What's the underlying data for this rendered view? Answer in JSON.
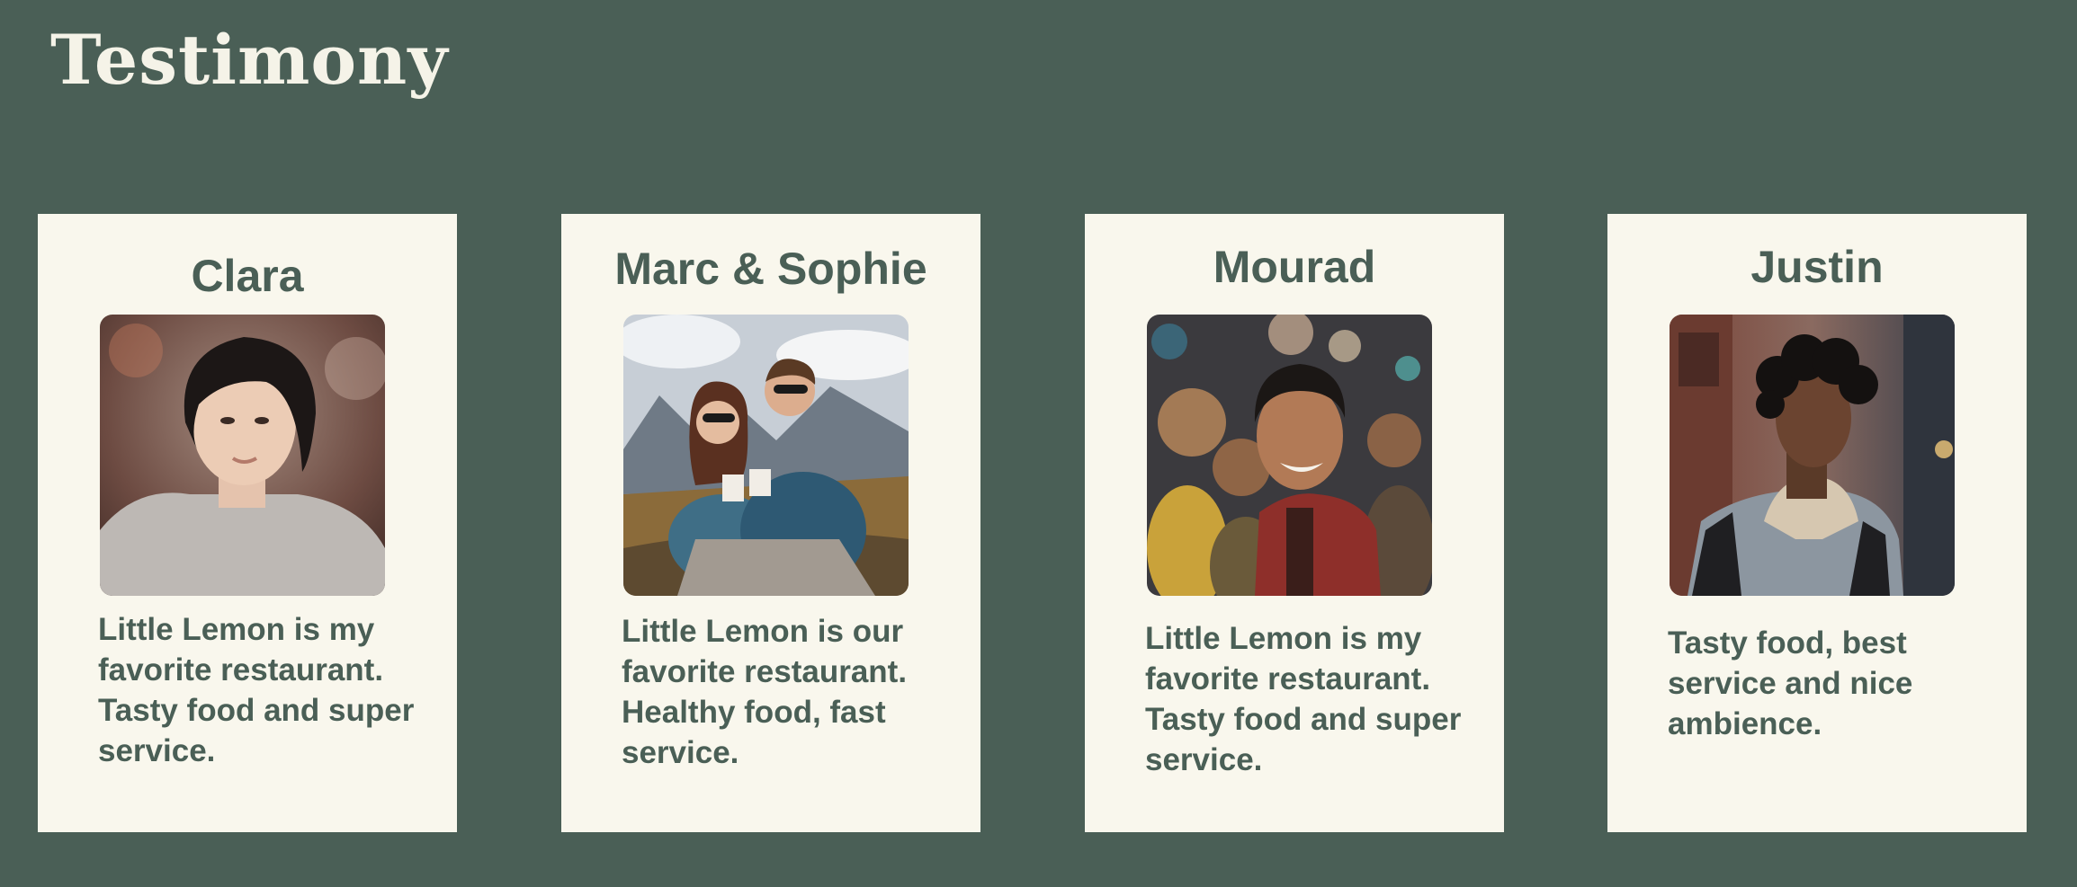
{
  "section": {
    "title": "Testimony"
  },
  "testimonials": [
    {
      "name": "Clara",
      "quote": "Little Lemon is my favorite restaurant. Tasty food and super service."
    },
    {
      "name": "Marc & Sophie",
      "quote": "Little Lemon is our favorite restaurant. Healthy food, fast service."
    },
    {
      "name": "Mourad",
      "quote": "Little Lemon is my favorite restaurant. Tasty food and super service."
    },
    {
      "name": "Justin",
      "quote": "Tasty food, best service and nice ambience."
    }
  ],
  "colors": {
    "background": "#4a5f56",
    "card": "#f9f7ed",
    "text": "#4a5f56",
    "title": "#f5f3e8"
  }
}
